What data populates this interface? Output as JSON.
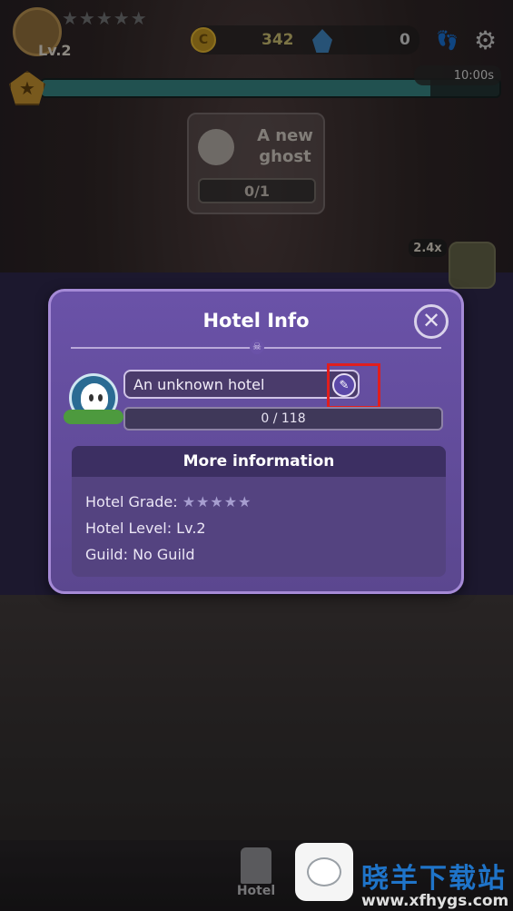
{
  "top_bar": {
    "level": "Lv.2",
    "coins": "342",
    "gems": "0",
    "timer": "10:00s",
    "hotel_progress_fraction": 0.85
  },
  "quest": {
    "title": "A new ghost",
    "progress": "0/1"
  },
  "side": {
    "speed": "2.4x"
  },
  "modal": {
    "title": "Hotel Info",
    "close_symbol": "✕",
    "hotel_name": "An unknown hotel",
    "exp": "0 / 118",
    "more_header": "More information",
    "grade_label": "Hotel Grade:",
    "grade_stars": "★★★★★",
    "level_label": "Hotel Level: Lv.2",
    "guild_label": "Guild: No Guild"
  },
  "bottom_nav": {
    "hotel_label": "Hotel"
  },
  "watermark": {
    "title": "晓羊下载站",
    "url": "www.xfhygs.com"
  },
  "colors": {
    "modal_bg": "#6a52a8",
    "highlight": "#e01e1e",
    "accent_teal": "#347d7b"
  }
}
